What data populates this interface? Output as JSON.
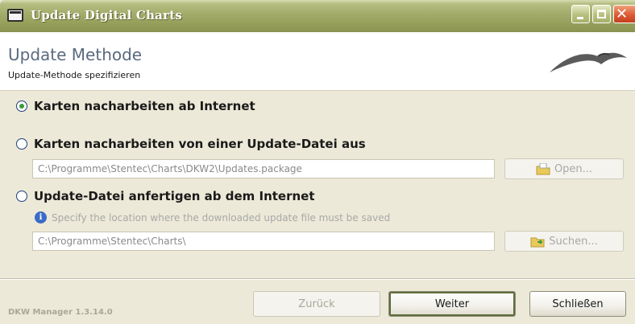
{
  "window": {
    "title": "Update Digital Charts"
  },
  "header": {
    "title": "Update Methode",
    "subtitle": "Update-Methode spezifizieren"
  },
  "options": [
    {
      "label": "Karten nacharbeiten ab Internet",
      "selected": true
    },
    {
      "label": "Karten nacharbeiten von einer Update-Datei aus",
      "selected": false
    },
    {
      "label": "Update-Datei anfertigen ab dem Internet",
      "selected": false
    }
  ],
  "update_file": {
    "path": "C:\\Programme\\Stentec\\Charts\\DKW2\\Updates.package",
    "button_label": "Open..."
  },
  "output": {
    "hint": "Specify the location where the downloaded update file must be saved",
    "path": "C:\\Programme\\Stentec\\Charts\\",
    "button_label": "Suchen..."
  },
  "footer": {
    "version": "DKW Manager 1.3.14.0",
    "back_label": "Zurück",
    "next_label": "Weiter",
    "close_label": "Schließen"
  },
  "icons": {
    "app": "window-icon",
    "logo": "seabird-logo-icon",
    "info": "info-icon",
    "open": "open-folder-icon",
    "browse": "browse-folder-icon"
  },
  "colors": {
    "titlebar": "#98a15c",
    "close_button": "#dc5b35",
    "accent_text": "#5a6a7e"
  }
}
